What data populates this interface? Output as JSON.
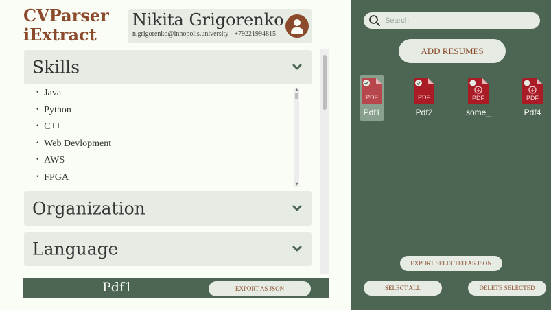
{
  "app": {
    "title_line1": "CVParser",
    "title_line2": "iExtract"
  },
  "user": {
    "name": "Nikita Grigorenko",
    "email": "n.grigorenko@innopolis.university",
    "phone": "+79221994815"
  },
  "sections": [
    {
      "title": "Skills",
      "expanded": true,
      "items": [
        "Java",
        "Python",
        "C++",
        "Web Devlopment",
        "AWS",
        "FPGA"
      ]
    },
    {
      "title": "Organization",
      "expanded": false
    },
    {
      "title": "Language",
      "expanded": false
    }
  ],
  "bottom_bar": {
    "current_file": "Pdf1",
    "export_label": "EXPORT AS JSON"
  },
  "search": {
    "placeholder": "Search",
    "value": ""
  },
  "add_resumes_label": "ADD RESUMES",
  "files": [
    {
      "name": "Pdf1",
      "selected": true,
      "badge": "check",
      "icon_text": "PDF"
    },
    {
      "name": "Pdf2",
      "selected": false,
      "badge": "check",
      "icon_text": "PDF"
    },
    {
      "name": "some_",
      "selected": false,
      "badge": "download",
      "icon_text": "PDF"
    },
    {
      "name": "Pdf4",
      "selected": false,
      "badge": "download",
      "icon_text": "PDF"
    }
  ],
  "actions": {
    "export_selected": "EXPORT SELECTED AS JSON",
    "select_all": "SELECT ALL",
    "delete_selected": "DELETE SELECTED"
  },
  "colors": {
    "brand": "#8b4a2b",
    "panel": "#4d6654",
    "card": "#e6ece4",
    "pdf": "#a91c26",
    "background": "#fafcf6"
  }
}
